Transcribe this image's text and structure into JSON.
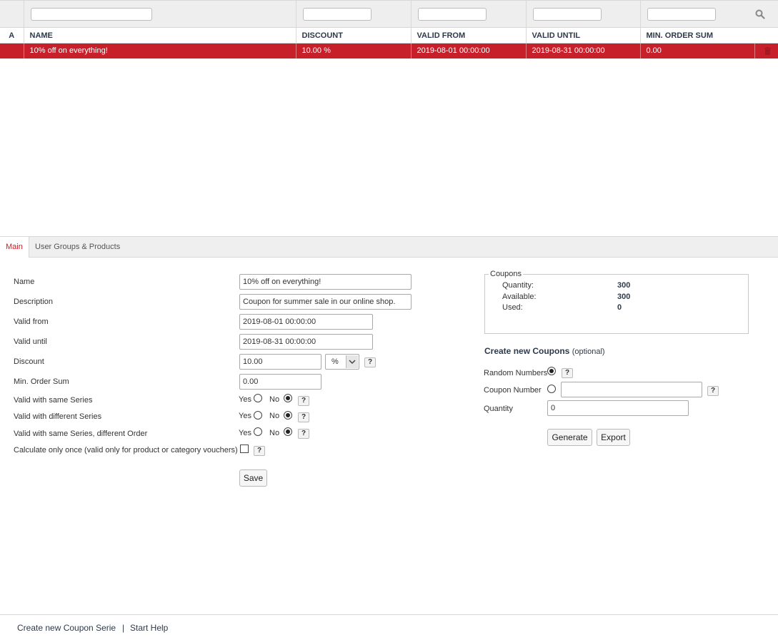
{
  "list": {
    "headers": [
      "A",
      "NAME",
      "DISCOUNT",
      "VALID FROM",
      "VALID UNTIL",
      "MIN. ORDER SUM"
    ],
    "rows": [
      {
        "a": "",
        "name": "10% off on everything!",
        "discount": "10.00 %",
        "valid_from": "2019-08-01 00:00:00",
        "valid_until": "2019-08-31 00:00:00",
        "min_order_sum": "0.00"
      }
    ],
    "selected_row_color": "#c8202a"
  },
  "tabs": [
    {
      "label": "Main",
      "active": true
    },
    {
      "label": "User Groups & Products",
      "active": false
    }
  ],
  "form": {
    "name_label": "Name",
    "name_value": "10% off on everything!",
    "description_label": "Description",
    "description_value": "Coupon for summer sale in our online shop.",
    "valid_from_label": "Valid from",
    "valid_from_value": "2019-08-01 00:00:00",
    "valid_until_label": "Valid until",
    "valid_until_value": "2019-08-31 00:00:00",
    "discount_label": "Discount",
    "discount_value": "10.00",
    "discount_unit": "%",
    "min_order_label": "Min. Order Sum",
    "min_order_value": "0.00",
    "same_series_label": "Valid with same Series",
    "diff_series_label": "Valid with different Series",
    "same_series_diff_order_label": "Valid with same Series, different Order",
    "calc_once_label": "Calculate only once (valid only for product or category vouchers)",
    "yes": "Yes",
    "no": "No",
    "help": "?",
    "save_label": "Save"
  },
  "coupons": {
    "legend": "Coupons",
    "quantity_label": "Quantity:",
    "quantity_value": "300",
    "available_label": "Available:",
    "available_value": "300",
    "used_label": "Used:",
    "used_value": "0",
    "create_title": "Create new Coupons",
    "create_optional": "(optional)",
    "random_label": "Random Numbers",
    "coupon_number_label": "Coupon Number",
    "coupon_number_value": "",
    "quantity_field_label": "Quantity",
    "quantity_field_value": "0",
    "generate_label": "Generate",
    "export_label": "Export"
  },
  "footer": {
    "create_link": "Create new Coupon Serie",
    "separator": "|",
    "help_link": "Start Help"
  },
  "icons": [
    "search-icon",
    "trash-icon",
    "chevron-down-icon"
  ]
}
